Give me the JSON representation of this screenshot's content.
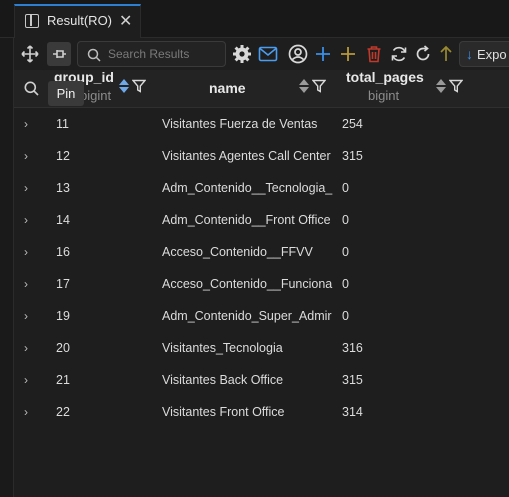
{
  "tab": {
    "title": "Result(RO)",
    "close": "✕"
  },
  "toolbar": {
    "search_placeholder": "Search Results",
    "export_label": "Expo",
    "tooltip": "Pin"
  },
  "columns": [
    {
      "name": "group_id",
      "type": "bigint"
    },
    {
      "name": "name",
      "type": ""
    },
    {
      "name": "total_pages",
      "type": "bigint"
    }
  ],
  "rows": [
    {
      "group_id": "11",
      "name": "Visitantes Fuerza de Ventas",
      "total_pages": "254"
    },
    {
      "group_id": "12",
      "name": "Visitantes Agentes Call Center",
      "total_pages": "315"
    },
    {
      "group_id": "13",
      "name": "Adm_Contenido__Tecnologia_",
      "total_pages": "0"
    },
    {
      "group_id": "14",
      "name": "Adm_Contenido__Front Office",
      "total_pages": "0"
    },
    {
      "group_id": "16",
      "name": "Acceso_Contenido__FFVV",
      "total_pages": "0"
    },
    {
      "group_id": "17",
      "name": "Acceso_Contenido__Funciona",
      "total_pages": "0"
    },
    {
      "group_id": "19",
      "name": "Adm_Contenido_Super_Admir",
      "total_pages": "0"
    },
    {
      "group_id": "20",
      "name": "Visitantes_Tecnologia",
      "total_pages": "316"
    },
    {
      "group_id": "21",
      "name": "Visitantes Back Office",
      "total_pages": "315"
    },
    {
      "group_id": "22",
      "name": "Visitantes Front Office",
      "total_pages": "314"
    }
  ],
  "colors": {
    "accent": "#2d7fd3",
    "add": "#3b8ee8",
    "add_gold": "#b89a3a",
    "delete": "#c0392b",
    "up_arrow": "#9a8a30"
  }
}
